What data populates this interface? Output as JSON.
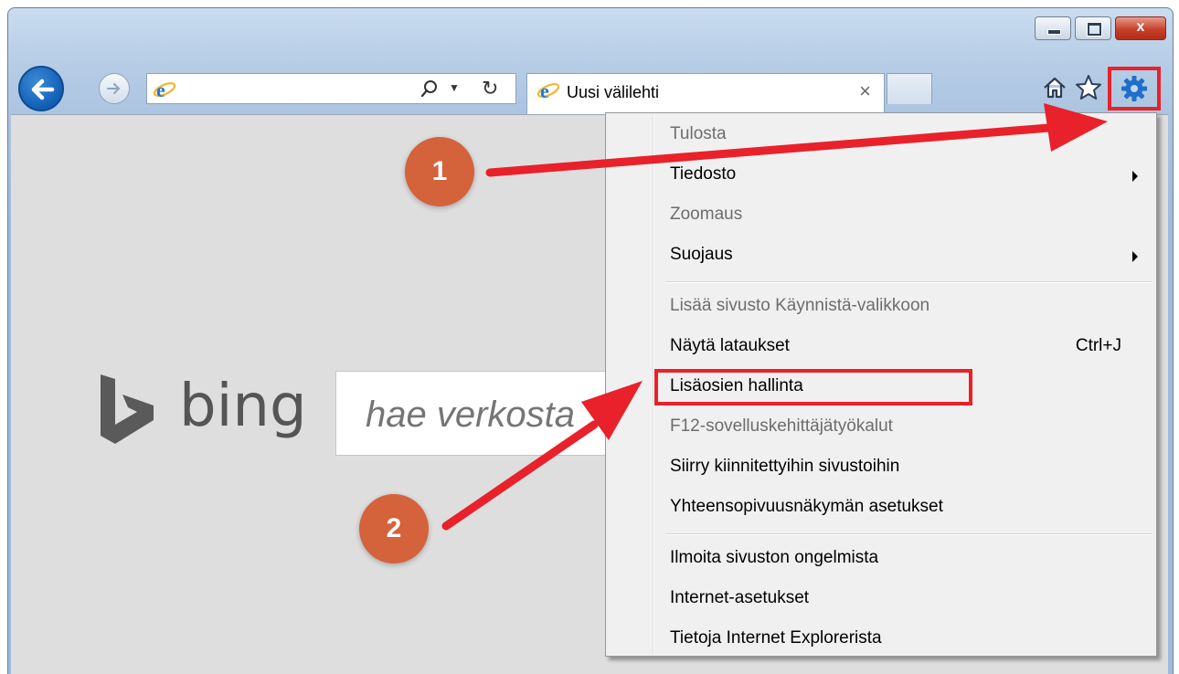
{
  "toolbar": {
    "address_value": "",
    "tab_title": "Uusi välilehti",
    "tab_close": "×",
    "close_caption": "x"
  },
  "bing": {
    "logo_text": "bing",
    "search_placeholder": "hae verkosta"
  },
  "menu": {
    "items": [
      {
        "label": "Tulosta",
        "disabled": true
      },
      {
        "label": "Tiedosto",
        "submenu": true
      },
      {
        "label": "Zoomaus",
        "disabled": true
      },
      {
        "label": "Suojaus",
        "submenu": true
      },
      {
        "label": "Lisää sivusto Käynnistä-valikkoon",
        "disabled": true
      },
      {
        "label": "Näytä lataukset",
        "shortcut": "Ctrl+J"
      },
      {
        "label": "Lisäosien hallinta"
      },
      {
        "label": "F12-sovelluskehittäjätyökalut",
        "disabled": true
      },
      {
        "label": "Siirry kiinnitettyihin sivustoihin"
      },
      {
        "label": "Yhteensopivuusnäkymän asetukset"
      },
      {
        "label": "Ilmoita sivuston ongelmista"
      },
      {
        "label": "Internet-asetukset"
      },
      {
        "label": "Tietoja Internet Explorerista"
      }
    ]
  },
  "annotations": {
    "step1": "1",
    "step2": "2"
  },
  "colors": {
    "annotation_red": "#e8212a",
    "badge_orange": "#d4623b",
    "ie_blue": "#1565c0"
  }
}
